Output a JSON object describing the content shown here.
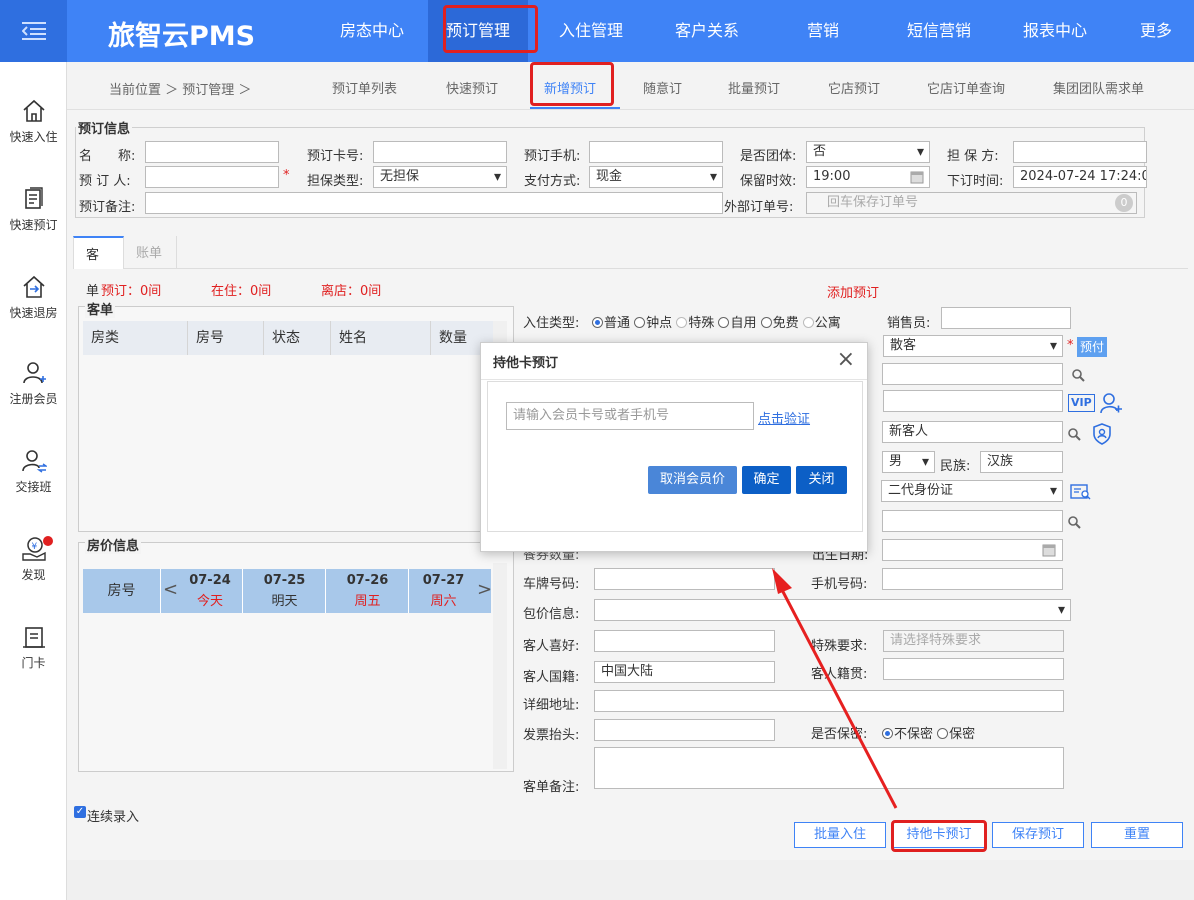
{
  "app": {
    "title": "旅智云PMS"
  },
  "nav": [
    "房态中心",
    "预订管理",
    "入住管理",
    "客户关系",
    "营销",
    "短信营销",
    "报表中心",
    "更多"
  ],
  "sidebar": [
    "快速入住",
    "快速预订",
    "快速退房",
    "注册会员",
    "交接班",
    "发现",
    "门卡"
  ],
  "breadcrumb": "当前位置 ＞ 预订管理 ＞",
  "subtabs": [
    "预订单列表",
    "快速预订",
    "新增预订",
    "随意订",
    "批量预订",
    "它店预订",
    "它店订单查询",
    "集团团队需求单"
  ],
  "booking_info": {
    "legend": "预订信息",
    "name_label": "名　　称:",
    "card_label": "预订卡号:",
    "phone_label": "预订手机:",
    "group_label": "是否团体:",
    "group_value": "否",
    "guarantor_label": "担 保 方:",
    "booker_label": "预 订 人:",
    "guarantee_type_label": "担保类型:",
    "guarantee_type_value": "无担保",
    "payment_label": "支付方式:",
    "payment_value": "现金",
    "hold_label": "保留时效:",
    "hold_value": "19:00",
    "order_time_label": "下订时间:",
    "order_time_value": "2024-07-24 17:24:0",
    "remark_label": "预订备注:",
    "external_label": "外部订单号:",
    "external_placeholder": "回车保存订单号",
    "external_count": "0"
  },
  "tabs": [
    "客单",
    "账单"
  ],
  "stats": {
    "booked": "预订：0间",
    "staying": "在住：0间",
    "left": "离店：0间"
  },
  "add_booking": "添加预订",
  "guest_list": {
    "legend": "客单",
    "columns": [
      "房类",
      "房号",
      "状态",
      "姓名",
      "数量"
    ]
  },
  "price_info": {
    "legend": "房价信息",
    "room_label": "房号",
    "days": [
      {
        "date": "07-24",
        "week": "今天"
      },
      {
        "date": "07-25",
        "week": "明天"
      },
      {
        "date": "07-26",
        "week": "周五"
      },
      {
        "date": "07-27",
        "week": "周六"
      }
    ]
  },
  "form": {
    "checkin_type_label": "入住类型:",
    "checkin_types": [
      "普通",
      "钟点",
      "特殊",
      "自用",
      "免费",
      "公寓"
    ],
    "sales_label": "销售员:",
    "guest_type_value": "散客",
    "prepay": "预付",
    "vip": "VIP",
    "guest_name_value": "新客人",
    "gender_value": "男",
    "ethnic_label": "民族:",
    "ethnic_value": "汉族",
    "id_type_value": "二代身份证",
    "plate_label": "车牌号码:",
    "mobile_label": "手机号码:",
    "package_label": "包价信息:",
    "preference_label": "客人喜好:",
    "special_label": "特殊要求:",
    "special_placeholder": "请选择特殊要求",
    "nationality_label": "客人国籍:",
    "nationality_value": "中国大陆",
    "native_label": "客人籍贯:",
    "address_label": "详细地址:",
    "invoice_label": "发票抬头:",
    "secret_label": "是否保密:",
    "secret_options": [
      "不保密",
      "保密"
    ],
    "remark_label": "客单备注:",
    "count_label": "餐券数量:",
    "birth_label": "出生日期:"
  },
  "continuous": "连续录入",
  "actions": [
    "批量入住",
    "持他卡预订",
    "保存预订",
    "重置"
  ],
  "dialog": {
    "title": "持他卡预订",
    "input_placeholder": "请输入会员卡号或者手机号",
    "verify_link": "点击验证",
    "cancel_member_price": "取消会员价",
    "confirm": "确定",
    "close": "关闭"
  }
}
